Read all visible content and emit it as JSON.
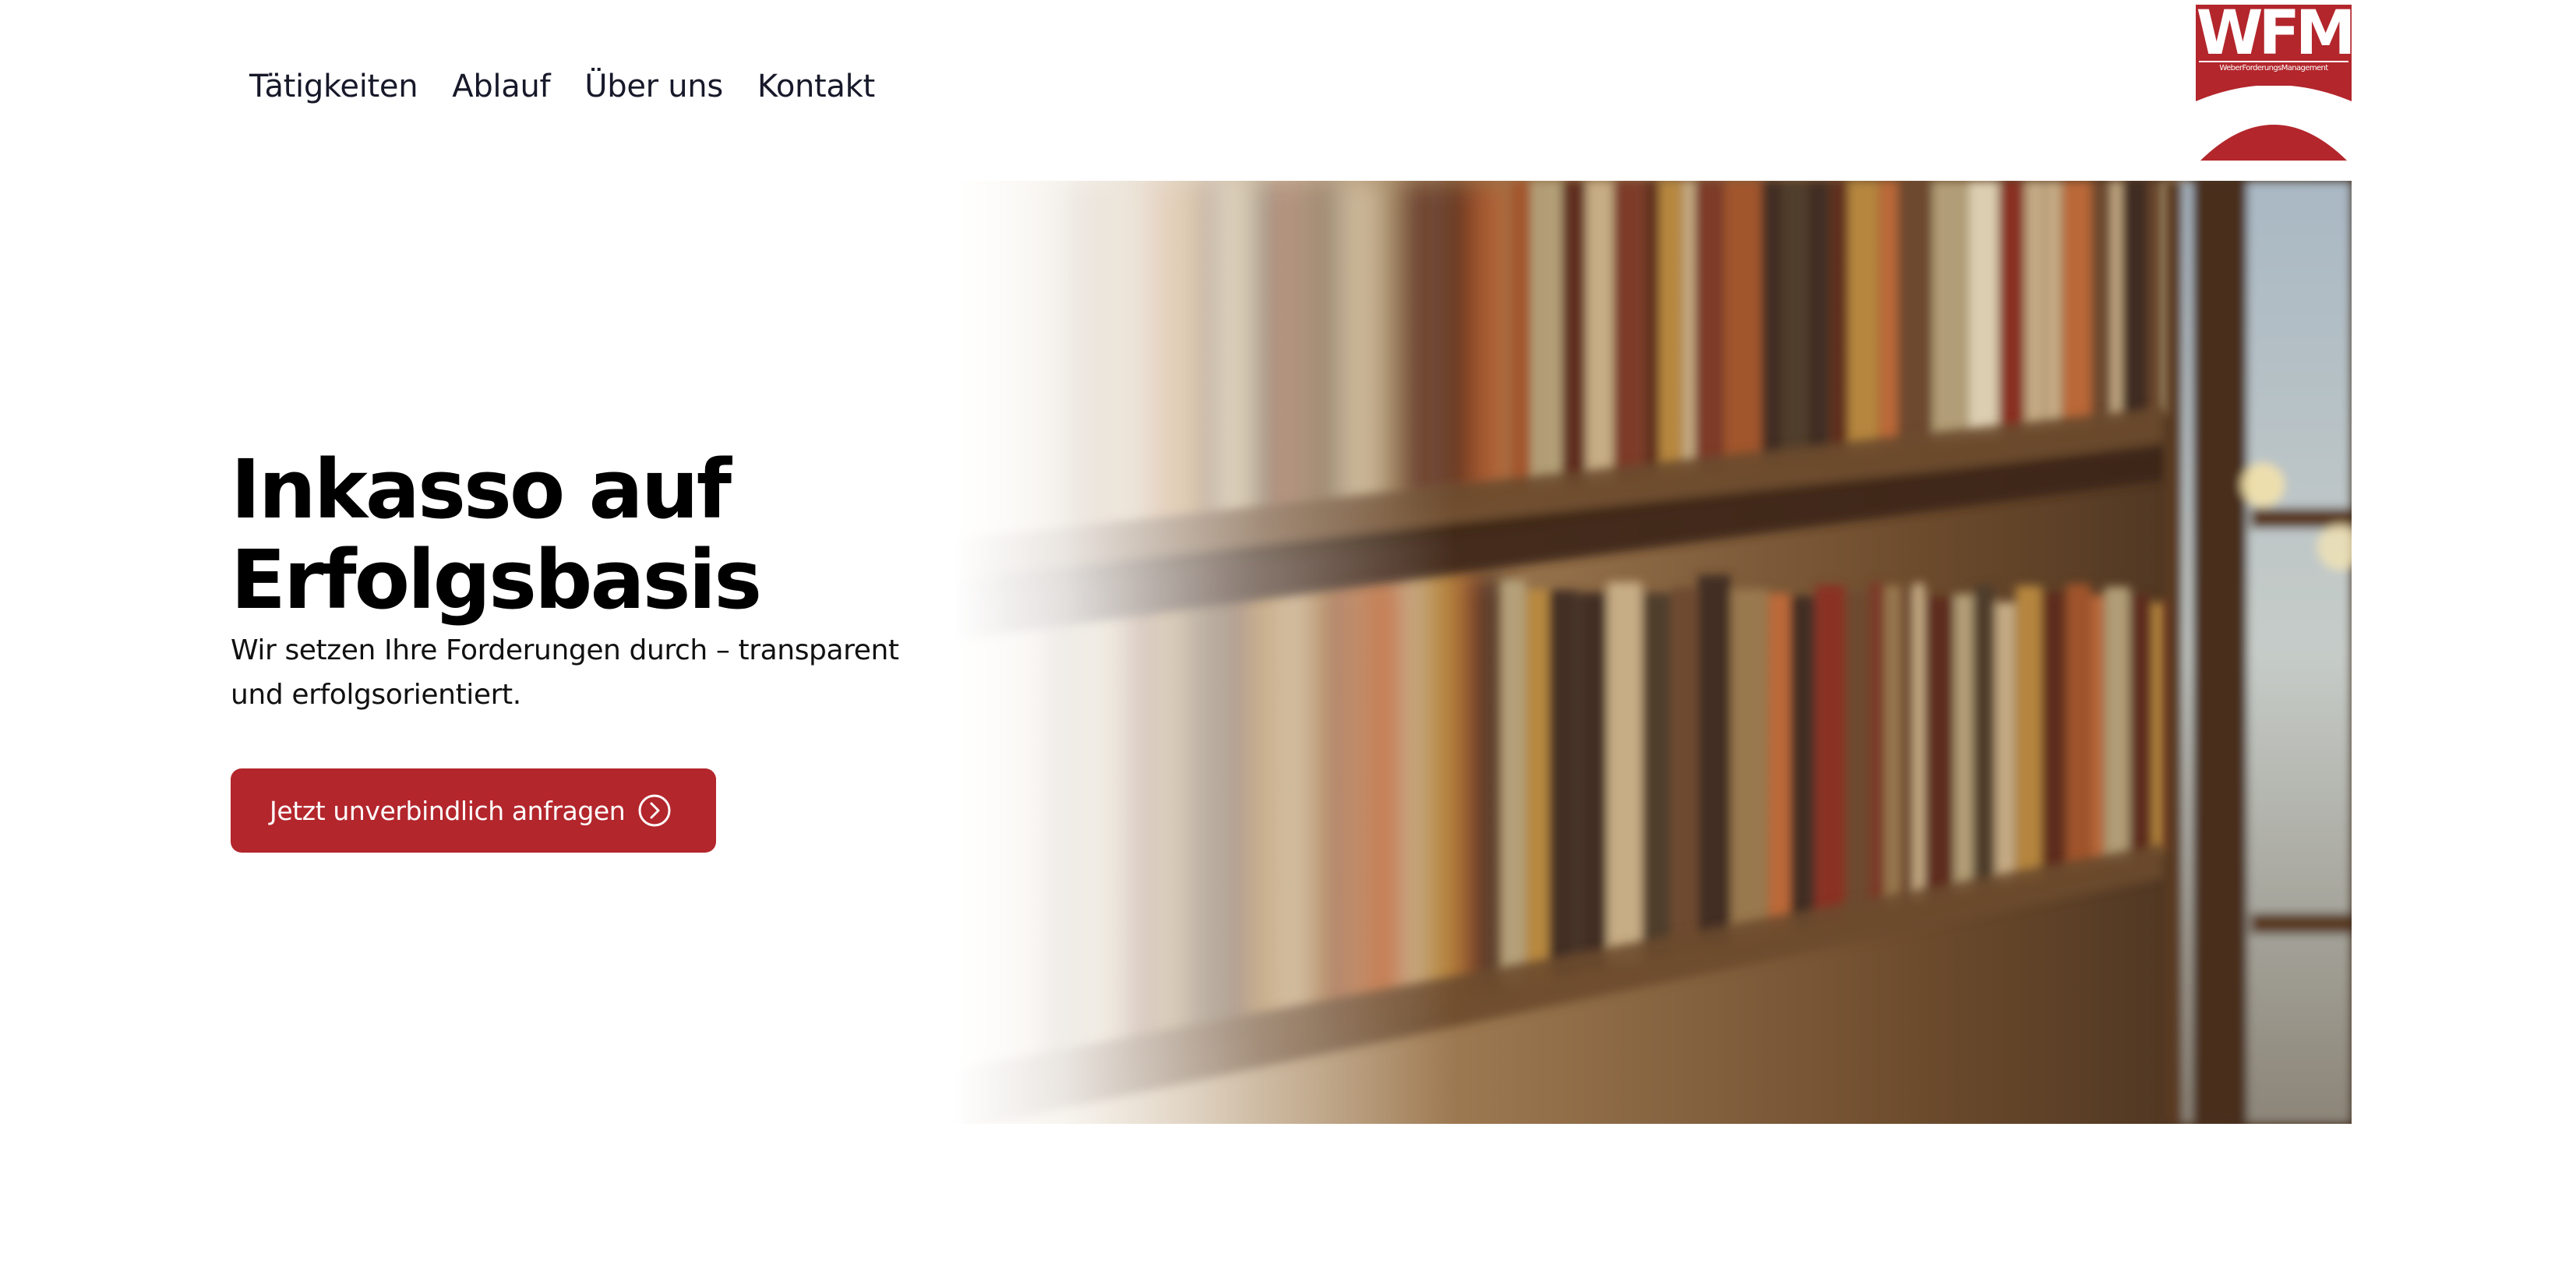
{
  "nav": {
    "items": [
      {
        "label": "Tätigkeiten"
      },
      {
        "label": "Ablauf"
      },
      {
        "label": "Über uns"
      },
      {
        "label": "Kontakt"
      }
    ]
  },
  "logo": {
    "letters": "WFM",
    "subtitle": "WeberForderungsManagement",
    "color": "#b3262c"
  },
  "hero": {
    "title_line1": "Inkasso auf",
    "title_line2": "Erfolgsbasis",
    "subtitle_line1": "Wir setzen Ihre Forderungen durch – transparent",
    "subtitle_line2": "und erfolgsorientiert.",
    "cta_label": "Jetzt unverbindlich anfragen",
    "cta_icon": "chevron-right-circle-icon",
    "image": "bookshelf-photo"
  },
  "colors": {
    "accent": "#b3262c",
    "text": "#17192a",
    "background": "#ffffff"
  }
}
